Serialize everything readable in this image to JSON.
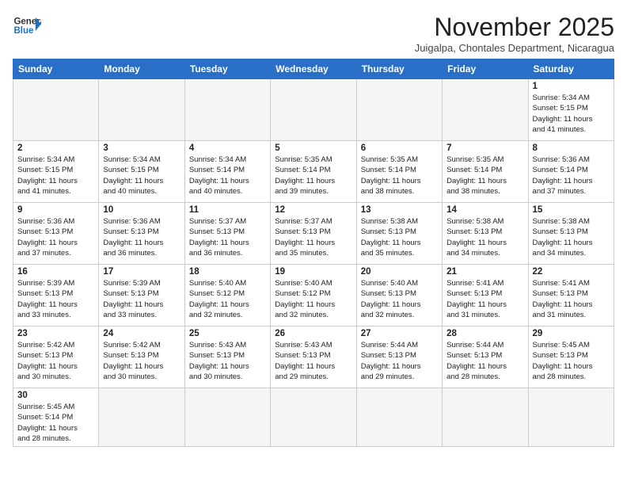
{
  "logo": {
    "line1": "General",
    "line2": "Blue"
  },
  "header": {
    "title": "November 2025",
    "subtitle": "Juigalpa, Chontales Department, Nicaragua"
  },
  "weekdays": [
    "Sunday",
    "Monday",
    "Tuesday",
    "Wednesday",
    "Thursday",
    "Friday",
    "Saturday"
  ],
  "weeks": [
    [
      {
        "day": "",
        "info": ""
      },
      {
        "day": "",
        "info": ""
      },
      {
        "day": "",
        "info": ""
      },
      {
        "day": "",
        "info": ""
      },
      {
        "day": "",
        "info": ""
      },
      {
        "day": "",
        "info": ""
      },
      {
        "day": "1",
        "info": "Sunrise: 5:34 AM\nSunset: 5:15 PM\nDaylight: 11 hours\nand 41 minutes."
      }
    ],
    [
      {
        "day": "2",
        "info": "Sunrise: 5:34 AM\nSunset: 5:15 PM\nDaylight: 11 hours\nand 41 minutes."
      },
      {
        "day": "3",
        "info": "Sunrise: 5:34 AM\nSunset: 5:15 PM\nDaylight: 11 hours\nand 40 minutes."
      },
      {
        "day": "4",
        "info": "Sunrise: 5:34 AM\nSunset: 5:14 PM\nDaylight: 11 hours\nand 40 minutes."
      },
      {
        "day": "5",
        "info": "Sunrise: 5:35 AM\nSunset: 5:14 PM\nDaylight: 11 hours\nand 39 minutes."
      },
      {
        "day": "6",
        "info": "Sunrise: 5:35 AM\nSunset: 5:14 PM\nDaylight: 11 hours\nand 38 minutes."
      },
      {
        "day": "7",
        "info": "Sunrise: 5:35 AM\nSunset: 5:14 PM\nDaylight: 11 hours\nand 38 minutes."
      },
      {
        "day": "8",
        "info": "Sunrise: 5:36 AM\nSunset: 5:14 PM\nDaylight: 11 hours\nand 37 minutes."
      }
    ],
    [
      {
        "day": "9",
        "info": "Sunrise: 5:36 AM\nSunset: 5:13 PM\nDaylight: 11 hours\nand 37 minutes."
      },
      {
        "day": "10",
        "info": "Sunrise: 5:36 AM\nSunset: 5:13 PM\nDaylight: 11 hours\nand 36 minutes."
      },
      {
        "day": "11",
        "info": "Sunrise: 5:37 AM\nSunset: 5:13 PM\nDaylight: 11 hours\nand 36 minutes."
      },
      {
        "day": "12",
        "info": "Sunrise: 5:37 AM\nSunset: 5:13 PM\nDaylight: 11 hours\nand 35 minutes."
      },
      {
        "day": "13",
        "info": "Sunrise: 5:38 AM\nSunset: 5:13 PM\nDaylight: 11 hours\nand 35 minutes."
      },
      {
        "day": "14",
        "info": "Sunrise: 5:38 AM\nSunset: 5:13 PM\nDaylight: 11 hours\nand 34 minutes."
      },
      {
        "day": "15",
        "info": "Sunrise: 5:38 AM\nSunset: 5:13 PM\nDaylight: 11 hours\nand 34 minutes."
      }
    ],
    [
      {
        "day": "16",
        "info": "Sunrise: 5:39 AM\nSunset: 5:13 PM\nDaylight: 11 hours\nand 33 minutes."
      },
      {
        "day": "17",
        "info": "Sunrise: 5:39 AM\nSunset: 5:13 PM\nDaylight: 11 hours\nand 33 minutes."
      },
      {
        "day": "18",
        "info": "Sunrise: 5:40 AM\nSunset: 5:12 PM\nDaylight: 11 hours\nand 32 minutes."
      },
      {
        "day": "19",
        "info": "Sunrise: 5:40 AM\nSunset: 5:12 PM\nDaylight: 11 hours\nand 32 minutes."
      },
      {
        "day": "20",
        "info": "Sunrise: 5:40 AM\nSunset: 5:13 PM\nDaylight: 11 hours\nand 32 minutes."
      },
      {
        "day": "21",
        "info": "Sunrise: 5:41 AM\nSunset: 5:13 PM\nDaylight: 11 hours\nand 31 minutes."
      },
      {
        "day": "22",
        "info": "Sunrise: 5:41 AM\nSunset: 5:13 PM\nDaylight: 11 hours\nand 31 minutes."
      }
    ],
    [
      {
        "day": "23",
        "info": "Sunrise: 5:42 AM\nSunset: 5:13 PM\nDaylight: 11 hours\nand 30 minutes."
      },
      {
        "day": "24",
        "info": "Sunrise: 5:42 AM\nSunset: 5:13 PM\nDaylight: 11 hours\nand 30 minutes."
      },
      {
        "day": "25",
        "info": "Sunrise: 5:43 AM\nSunset: 5:13 PM\nDaylight: 11 hours\nand 30 minutes."
      },
      {
        "day": "26",
        "info": "Sunrise: 5:43 AM\nSunset: 5:13 PM\nDaylight: 11 hours\nand 29 minutes."
      },
      {
        "day": "27",
        "info": "Sunrise: 5:44 AM\nSunset: 5:13 PM\nDaylight: 11 hours\nand 29 minutes."
      },
      {
        "day": "28",
        "info": "Sunrise: 5:44 AM\nSunset: 5:13 PM\nDaylight: 11 hours\nand 28 minutes."
      },
      {
        "day": "29",
        "info": "Sunrise: 5:45 AM\nSunset: 5:13 PM\nDaylight: 11 hours\nand 28 minutes."
      }
    ],
    [
      {
        "day": "30",
        "info": "Sunrise: 5:45 AM\nSunset: 5:14 PM\nDaylight: 11 hours\nand 28 minutes."
      },
      {
        "day": "",
        "info": ""
      },
      {
        "day": "",
        "info": ""
      },
      {
        "day": "",
        "info": ""
      },
      {
        "day": "",
        "info": ""
      },
      {
        "day": "",
        "info": ""
      },
      {
        "day": "",
        "info": ""
      }
    ]
  ]
}
